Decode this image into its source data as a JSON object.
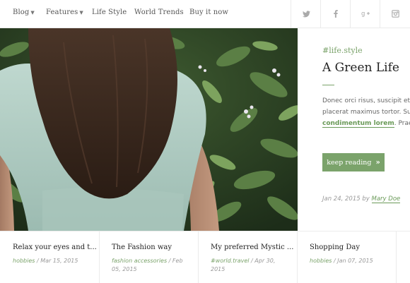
{
  "nav": {
    "items": [
      {
        "label": "Blog",
        "caret": true
      },
      {
        "label": "Features",
        "caret": true
      },
      {
        "label": "Life Style",
        "caret": false
      },
      {
        "label": "World Trends",
        "caret": false
      },
      {
        "label": "Buy it now",
        "caret": false
      }
    ],
    "social": [
      "twitter-icon",
      "facebook-icon",
      "google-plus-icon",
      "instagram-icon"
    ]
  },
  "featured": {
    "tag": "#life.style",
    "title": "A Green Life",
    "excerpt_line1": "Donec orci risus, suscipit et e",
    "excerpt_line2": "placerat maximus tortor. Sus",
    "excerpt_link": "condimentum lorem",
    "excerpt_line3_tail": ". Praes",
    "button_label": "keep reading",
    "date": "Jan 24, 2015",
    "by": "by",
    "author": "Mary Doe"
  },
  "cards": [
    {
      "title": "Relax your eyes and t...",
      "category": "hobbies",
      "date": "Mar 15, 2015"
    },
    {
      "title": "The Fashion way",
      "category": "fashion accessories",
      "date": "Feb 05, 2015"
    },
    {
      "title": "My preferred Mystic ...",
      "category": "#world.travel",
      "date": "Apr 30, 2015"
    },
    {
      "title": "Shopping Day",
      "category": "hobbies",
      "date": "Jan 07, 2015"
    }
  ],
  "colors": {
    "accent": "#7ba36b",
    "border": "#ebebeb",
    "text": "#333333"
  }
}
